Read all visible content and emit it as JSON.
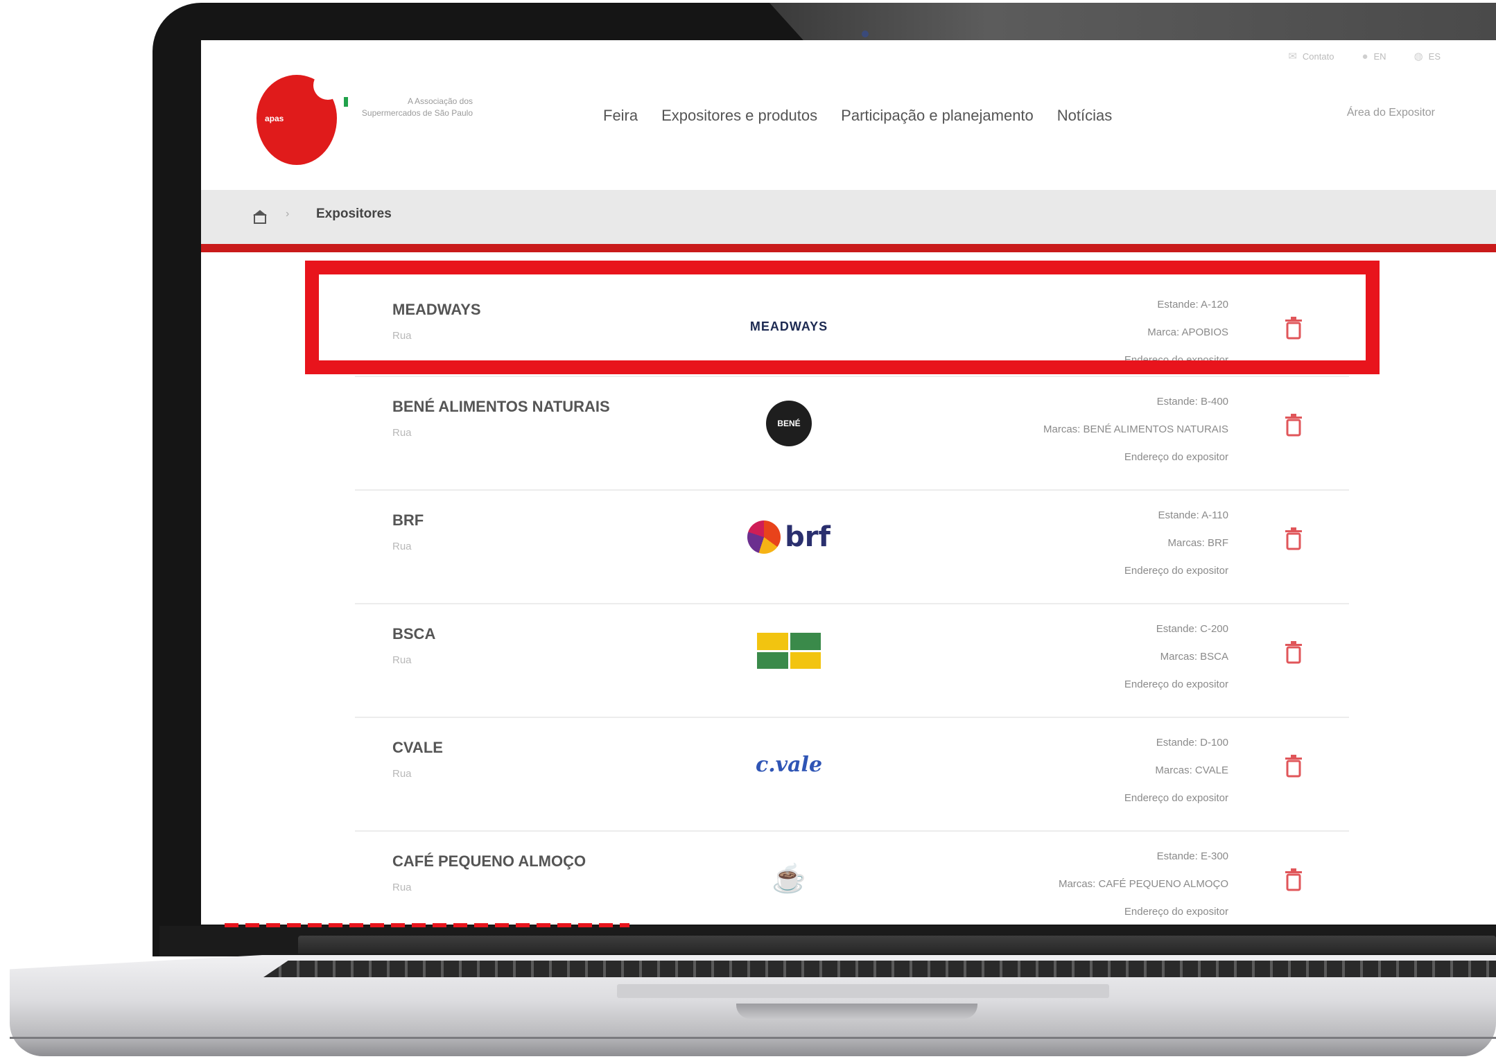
{
  "topbar": {
    "items": [
      {
        "icon": "mail-icon",
        "label": "Contato"
      },
      {
        "icon": "user-icon",
        "label": "EN"
      },
      {
        "icon": "globe-icon",
        "label": "ES"
      }
    ]
  },
  "header": {
    "logo_text": "apas",
    "tagline": "A Associação dos Supermercados de São Paulo",
    "nav": [
      "Feira",
      "Expositores e produtos",
      "Participação e planejamento",
      "Notícias"
    ],
    "account_label": "Área do Expositor"
  },
  "breadcrumb": {
    "home_icon": "home-icon",
    "current": "Expositores"
  },
  "exhibitors": [
    {
      "name": "MEADWAYS",
      "category": "Rua",
      "logo_type": "wordmark",
      "logo_text": "MEADWAYS",
      "info": [
        "Estande: A-120",
        "Marca: APOBIOS",
        "Endereço do expositor"
      ]
    },
    {
      "name": "BENÉ ALIMENTOS NATURAIS",
      "category": "Rua",
      "logo_type": "badge",
      "logo_text": "BENÉ",
      "info": [
        "Estande: B-400",
        "Marcas: BENÉ ALIMENTOS NATURAIS",
        "Endereço do expositor"
      ]
    },
    {
      "name": "BRF",
      "category": "Rua",
      "logo_type": "brf",
      "logo_text": "brf",
      "info": [
        "Estande: A-110",
        "Marcas: BRF",
        "Endereço do expositor"
      ]
    },
    {
      "name": "BSCA",
      "category": "Rua",
      "logo_type": "bsca",
      "logo_text": "",
      "info": [
        "Estande: C-200",
        "Marcas: BSCA",
        "Endereço do expositor"
      ]
    },
    {
      "name": "CVALE",
      "category": "Rua",
      "logo_type": "vale",
      "logo_text": "c.vale",
      "info": [
        "Estande: D-100",
        "Marcas: CVALE",
        "Endereço do expositor"
      ]
    },
    {
      "name": "CAFÉ PEQUENO ALMOÇO",
      "category": "Rua",
      "logo_type": "sketch",
      "logo_text": "☕",
      "info": [
        "Estande: E-300",
        "Marcas: CAFÉ PEQUENO ALMOÇO",
        "Endereço do expositor"
      ]
    }
  ],
  "colors": {
    "brand_red": "#e01b1b",
    "highlight_red": "#e8141c",
    "rule_red": "#c91a1a"
  }
}
